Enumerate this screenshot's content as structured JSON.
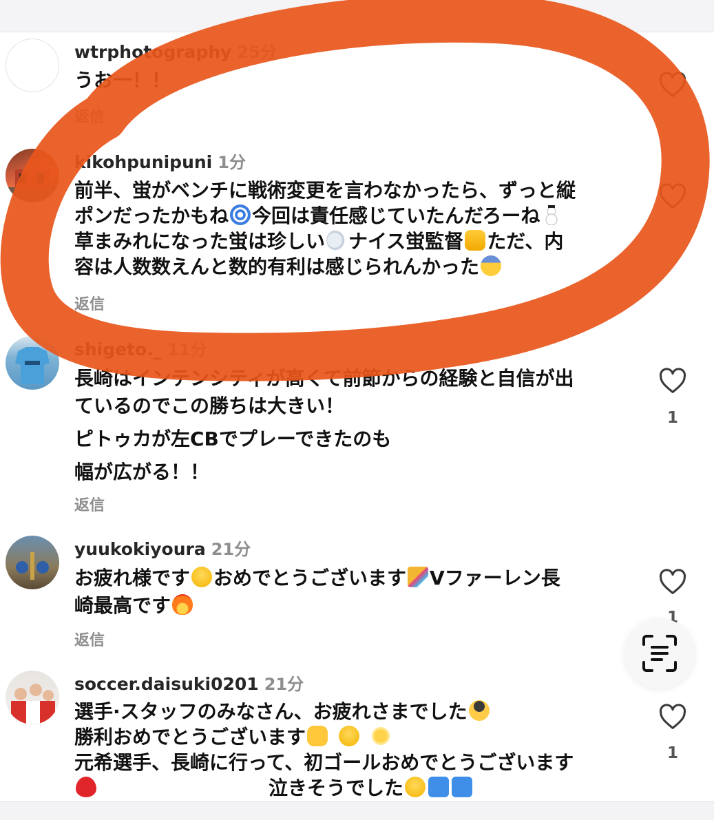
{
  "comments": [
    {
      "username": "wtrphotography",
      "time": "25分",
      "lines": [
        "うお一！！"
      ],
      "reply": "返信",
      "likes": ""
    },
    {
      "username": "kikohpunipuni",
      "time": "1分",
      "lines": [
        "前半、蛍がベンチに戦術変更を言わなかったら、ずっと縦",
        "ポンだったかもね",
        "今回は責任感じていたんだろーね",
        "草まみれになった蛍は珍しい",
        "ナイス蛍監督",
        "ただ、内",
        "容は人数数えんと数的有利は感じられんかった"
      ],
      "reply": "返信",
      "likes": ""
    },
    {
      "username": "shigeto._",
      "time": "11分",
      "lines": [
        "長崎はインテンシティが高くて前節からの経験と自信が出",
        "ているのでこの勝ちは大きい！",
        "ピトゥカが左CBでプレーできたのも",
        "幅が広がる！！"
      ],
      "reply": "返信",
      "likes": "1"
    },
    {
      "username": "yuukokiyoura",
      "time": "21分",
      "lines": [
        "お疲れ様です",
        "おめでとうございます",
        "Vファーレン長",
        "崎最高です"
      ],
      "reply": "返信",
      "likes": "1"
    },
    {
      "username": "soccer.daisuki0201",
      "time": "21分",
      "lines": [
        "選手·スタッフのみなさん、お疲れさまでした",
        "勝利おめでとうございます",
        "元希選手、長崎に行って、初ゴールおめでとうございます",
        "泣きそうでした"
      ],
      "reply": "",
      "likes": "1"
    }
  ],
  "icons": {
    "heart": "heart-icon",
    "scan": "text-scan-icon"
  },
  "colors": {
    "highlight": "#e8561b",
    "muted": "#8e8e8e"
  }
}
